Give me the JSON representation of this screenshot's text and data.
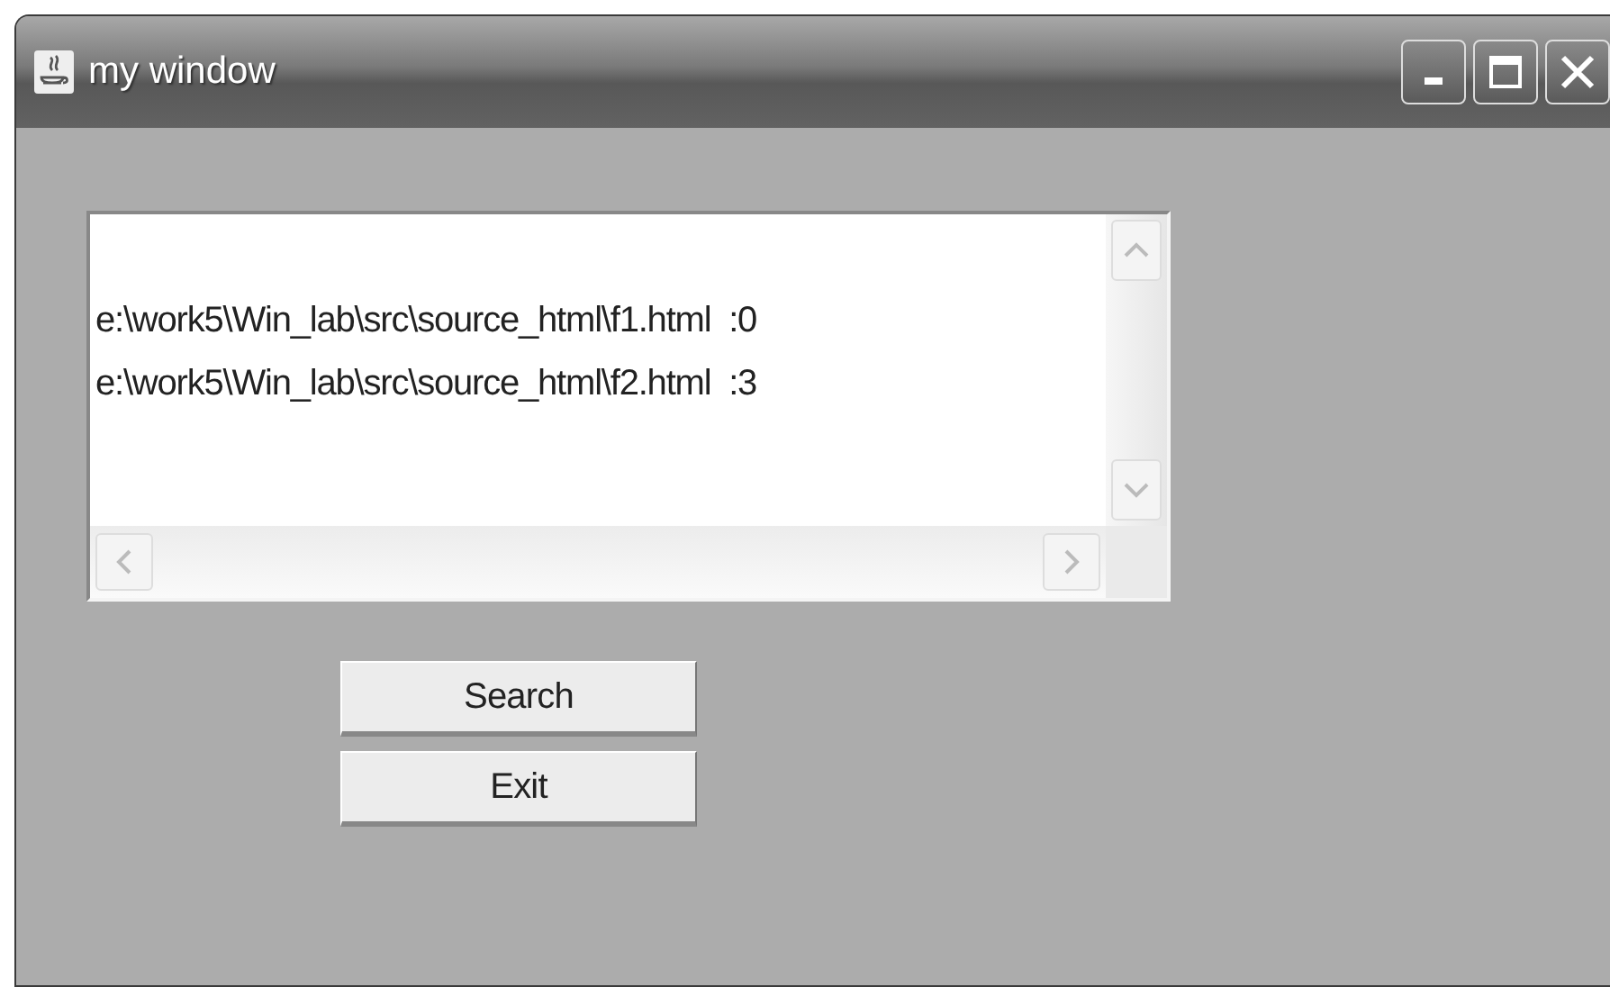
{
  "window": {
    "title": "my window"
  },
  "text_area": {
    "lines": [
      "e:\\work5\\Win_lab\\src\\source_html\\f1.html  :0",
      "e:\\work5\\Win_lab\\src\\source_html\\f2.html  :3"
    ]
  },
  "buttons": [
    "Search",
    "Exit"
  ]
}
